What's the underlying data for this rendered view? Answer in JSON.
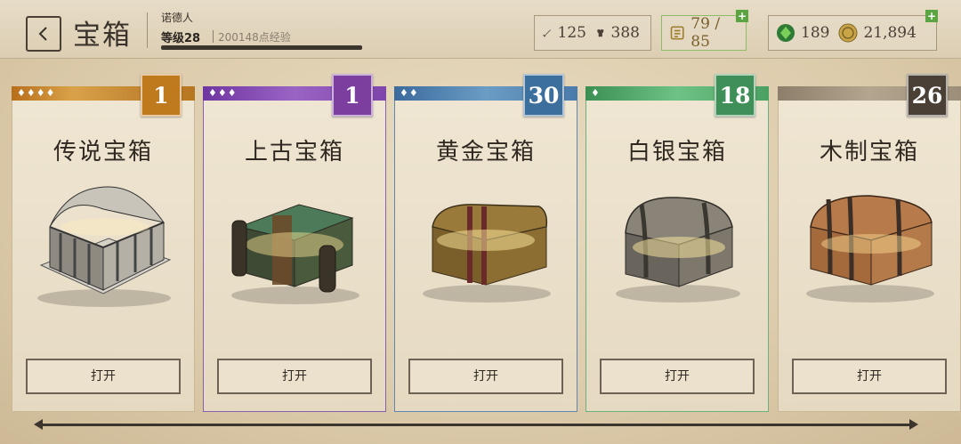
{
  "header": {
    "title": "宝箱",
    "player_name": "诺德人",
    "level": "等级28",
    "exp": "200148点经验",
    "exp_progress": 1.0
  },
  "resources": {
    "attack": "125",
    "defense": "388",
    "capacity": "79 / 85",
    "gems": "189",
    "gold": "21,894"
  },
  "colors": {
    "legendary": "#c07a1e",
    "ancient": "#7c3fa0",
    "gold": "#3c6f9c",
    "silver": "#3f8f58",
    "wood": "#4a4036"
  },
  "chests": [
    {
      "name": "传说宝箱",
      "count": "1",
      "diamonds": "♦♦♦♦",
      "open_label": "打开"
    },
    {
      "name": "上古宝箱",
      "count": "1",
      "diamonds": "♦♦♦",
      "open_label": "打开"
    },
    {
      "name": "黄金宝箱",
      "count": "30",
      "diamonds": "♦♦",
      "open_label": "打开"
    },
    {
      "name": "白银宝箱",
      "count": "18",
      "diamonds": "♦",
      "open_label": "打开"
    },
    {
      "name": "木制宝箱",
      "count": "26",
      "diamonds": "",
      "open_label": "打开"
    }
  ]
}
